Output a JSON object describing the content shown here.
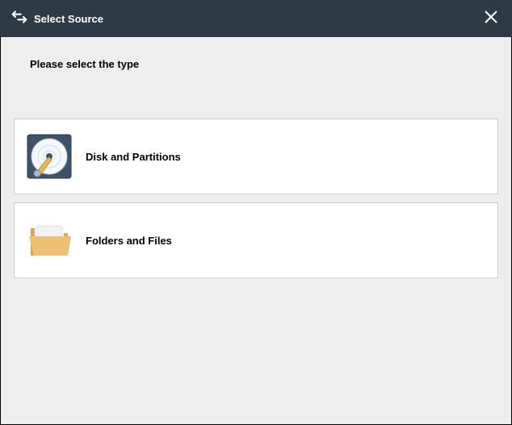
{
  "titlebar": {
    "title": "Select Source"
  },
  "prompt": "Please select the type",
  "options": [
    {
      "label": "Disk and Partitions"
    },
    {
      "label": "Folders and Files"
    }
  ]
}
